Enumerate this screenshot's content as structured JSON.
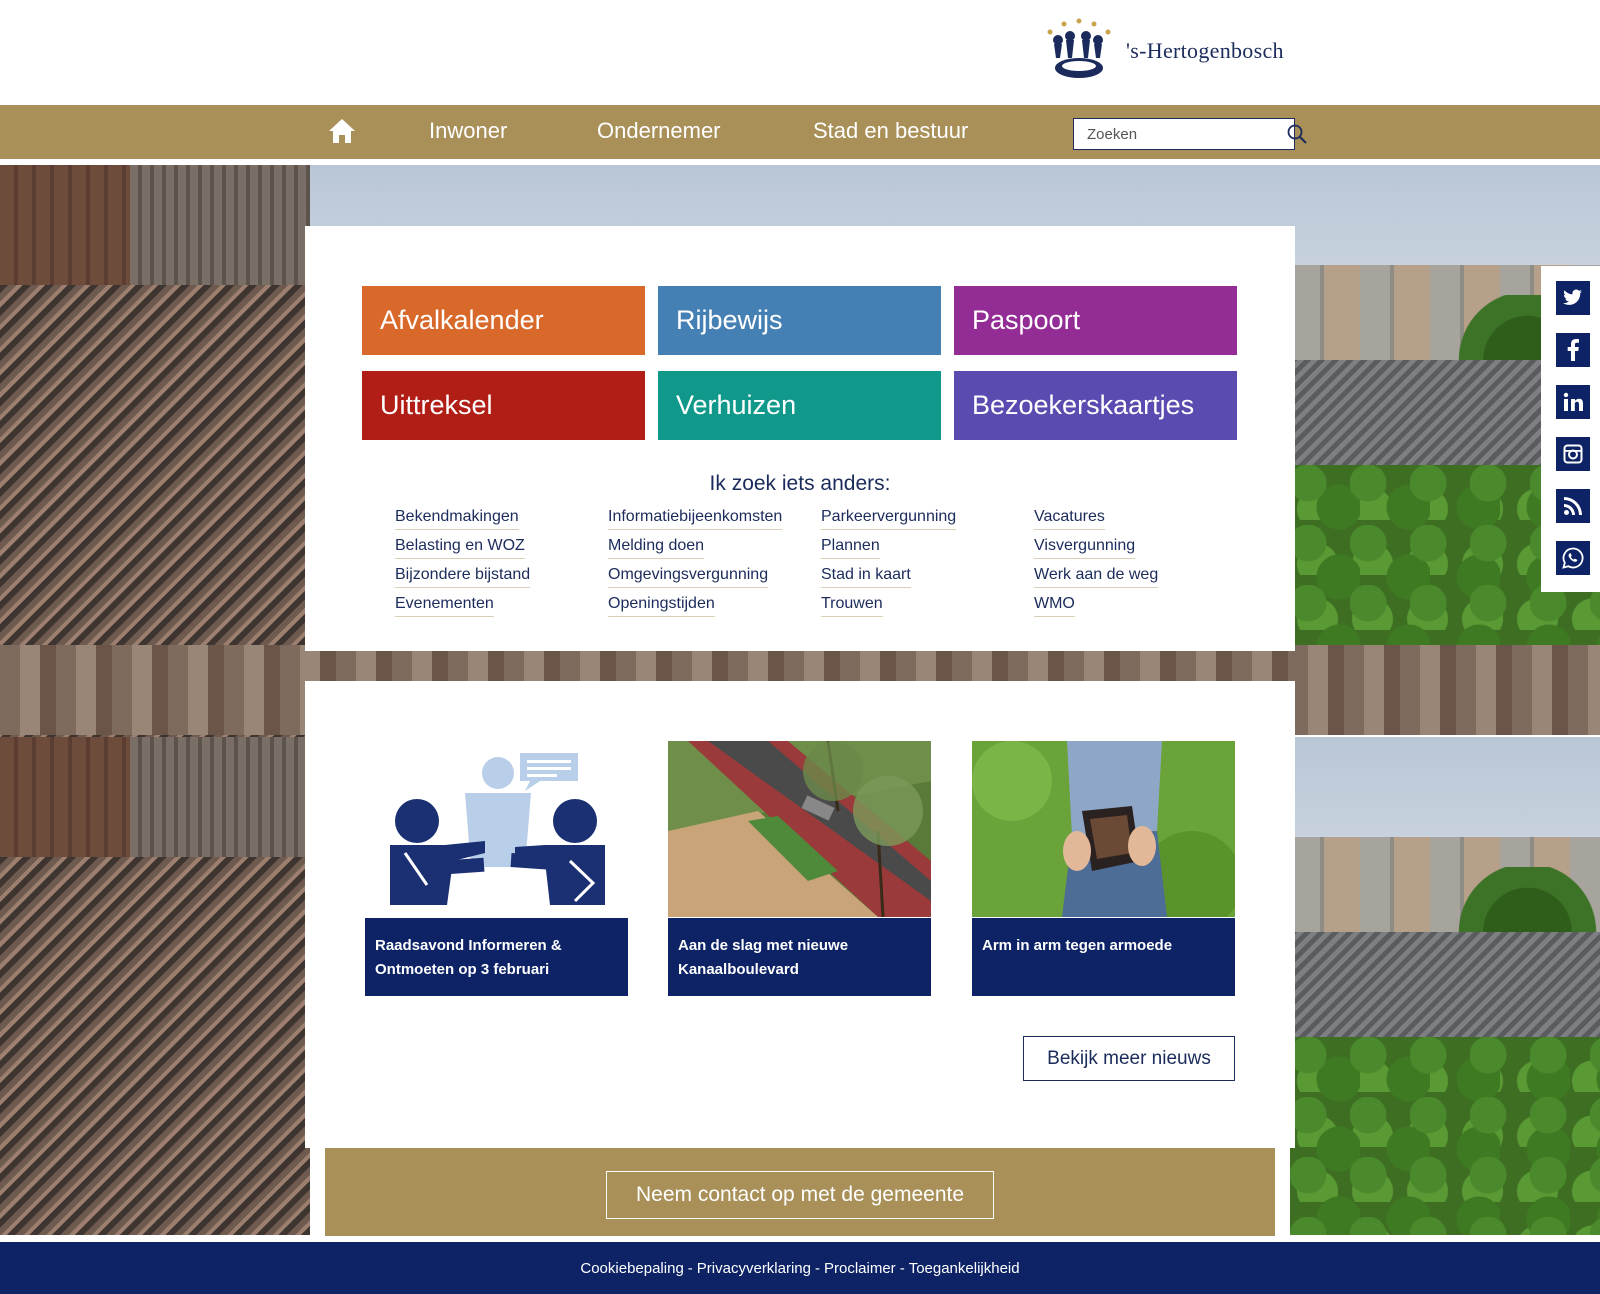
{
  "header": {
    "logo_text": "'s-Hertogenbosch"
  },
  "nav": {
    "home_icon": "home-icon",
    "items": [
      "Inwoner",
      "Ondernemer",
      "Stad en bestuur"
    ],
    "search_placeholder": "Zoeken"
  },
  "tiles": [
    {
      "label": "Afvalkalender",
      "color": "#d9692a"
    },
    {
      "label": "Rijbewijs",
      "color": "#4580b4"
    },
    {
      "label": "Paspoort",
      "color": "#942c96"
    },
    {
      "label": "Uittreksel",
      "color": "#b01e16"
    },
    {
      "label": "Verhuizen",
      "color": "#10998a"
    },
    {
      "label": "Bezoekerskaartjes",
      "color": "#5a4bb0"
    }
  ],
  "other": {
    "title": "Ik zoek iets anders:",
    "links": [
      "Bekendmakingen",
      "Informatiebijeenkomsten",
      "Parkeervergunning",
      "Vacatures",
      "Belasting en WOZ",
      "Melding doen",
      "Plannen",
      "Visvergunning",
      "Bijzondere bijstand",
      "Omgevingsvergunning",
      "Stad in kaart",
      "Werk aan de weg",
      "Evenementen",
      "Openingstijden",
      "Trouwen",
      "WMO"
    ]
  },
  "news": {
    "items": [
      {
        "title": "Raadsavond Informeren & Ontmoeten op 3 februari"
      },
      {
        "title": "Aan de slag met nieuwe Kanaalboulevard"
      },
      {
        "title": "Arm in arm tegen armoede"
      }
    ],
    "more_label": "Bekijk meer nieuws"
  },
  "contact": {
    "label": "Neem contact op met de gemeente"
  },
  "footer": {
    "links": [
      "Cookiebepaling",
      "Privacyverklaring",
      "Proclaimer",
      "Toegankelijkheid"
    ],
    "separator": "-"
  },
  "social": [
    "twitter-icon",
    "facebook-icon",
    "linkedin-icon",
    "instagram-icon",
    "rss-icon",
    "whatsapp-icon"
  ],
  "colors": {
    "brand_gold": "#a99058",
    "brand_navy": "#0d2366"
  }
}
